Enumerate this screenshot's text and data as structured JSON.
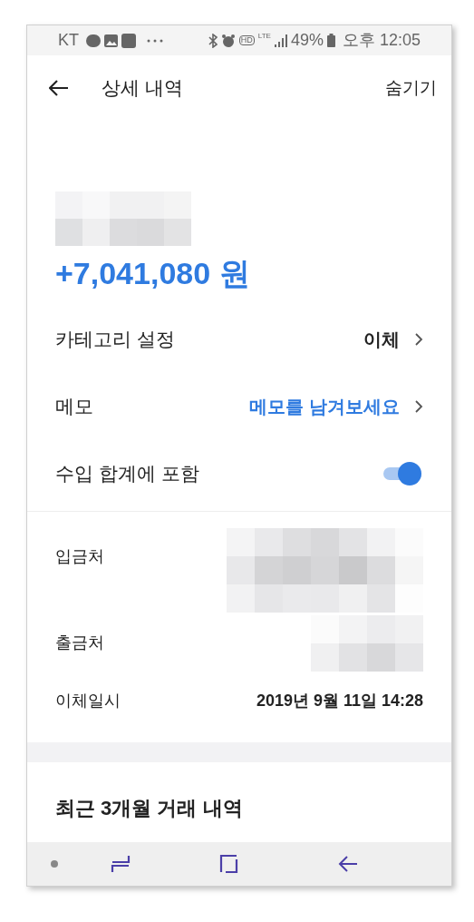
{
  "status_bar": {
    "carrier": "KT",
    "hd_badge": "HD",
    "network": "LTE",
    "battery": "49%",
    "time": "오후 12:05"
  },
  "header": {
    "title": "상세 내역",
    "action": "숨기기"
  },
  "amount": "+7,041,080 원",
  "settings": [
    {
      "kind": "link",
      "label": "카테고리 설정",
      "value": "이체",
      "accent": false
    },
    {
      "kind": "link",
      "label": "메모",
      "value": "메모를 남겨보세요",
      "accent": true
    },
    {
      "kind": "toggle",
      "label": "수입 합계에 포함",
      "on": true
    }
  ],
  "details": [
    {
      "kind": "redacted",
      "label": "입금처"
    },
    {
      "kind": "redacted",
      "label": "출금처"
    },
    {
      "kind": "text",
      "label": "이체일시",
      "value": "2019년 9월 11일 14:28"
    }
  ],
  "recent_section": {
    "title": "최근 3개월 거래 내역"
  }
}
